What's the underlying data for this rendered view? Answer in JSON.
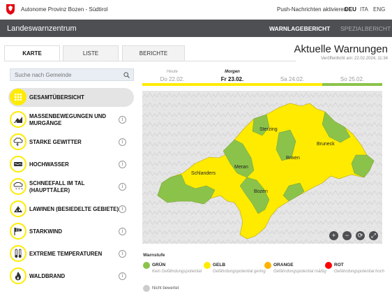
{
  "header": {
    "org": "Autonome Provinz Bozen - Südtirol",
    "push": "Push-Nachrichten aktivieren",
    "languages": [
      "DEU",
      "ITA",
      "ENG"
    ],
    "active_language": "DEU"
  },
  "nav": {
    "title": "Landeswarnzentrum",
    "links": [
      "WARNLAGEBERICHT",
      "SPEZIALBERICHT"
    ]
  },
  "tabs": [
    "KARTE",
    "LISTE",
    "BERICHTE"
  ],
  "page": {
    "title": "Aktuelle Warnungen",
    "published": "Veröffentlicht am: 22.02.2024, 11:34"
  },
  "search": {
    "placeholder": "Suche nach Gemeinde"
  },
  "sidebar": {
    "items": [
      {
        "label": "GESAMTÜBERSICHT",
        "icon": "grid-icon"
      },
      {
        "label": "MASSENBEWEGUNGEN UND MURGÄNGE",
        "icon": "landslide-icon"
      },
      {
        "label": "STARKE GEWITTER",
        "icon": "thunderstorm-icon"
      },
      {
        "label": "HOCHWASSER",
        "icon": "flood-icon"
      },
      {
        "label": "SCHNEEFALL IM TAL (HAUPTTÄLER)",
        "icon": "snowfall-icon"
      },
      {
        "label": "LAWINEN (BESIEDELTE GEBIETE)",
        "icon": "avalanche-icon"
      },
      {
        "label": "STARKWIND",
        "icon": "wind-icon"
      },
      {
        "label": "EXTREME TEMPERATUREN",
        "icon": "thermometer-icon"
      },
      {
        "label": "WALDBRAND",
        "icon": "fire-icon"
      }
    ]
  },
  "days": [
    {
      "small": "Heute",
      "main": "Do 22.02."
    },
    {
      "small": "Morgen",
      "main": "Fr 23.02."
    },
    {
      "small": "",
      "main": "Sa 24.02."
    },
    {
      "small": "",
      "main": "So 25.02."
    }
  ],
  "day_colors": [
    "#ffeb00",
    "#ffeb00",
    "#ffeb00",
    "#8bc34a"
  ],
  "map": {
    "cities": [
      "Sterzing",
      "Bruneck",
      "Brixen",
      "Schlanders",
      "Meran",
      "Bozen"
    ],
    "controls": [
      "+",
      "−",
      "⟳",
      "⤢"
    ]
  },
  "legend": {
    "title": "Warnstufe",
    "levels": [
      {
        "name": "GRÜN",
        "desc": "Kein Gefährdungspotential",
        "color": "#8bc34a"
      },
      {
        "name": "GELB",
        "desc": "Gefährdungspotential gering",
        "color": "#ffeb00"
      },
      {
        "name": "ORANGE",
        "desc": "Gefährdungspotential mäßig",
        "color": "#ffb300"
      },
      {
        "name": "ROT",
        "desc": "Gefährdungspotential hoch",
        "color": "#ff0000"
      }
    ],
    "unrated": {
      "label": "Nicht bewertet",
      "color": "#cccccc"
    }
  },
  "colors": {
    "yellow": "#ffeb00",
    "green": "#8bc34a",
    "dark": "#4d4f53"
  }
}
